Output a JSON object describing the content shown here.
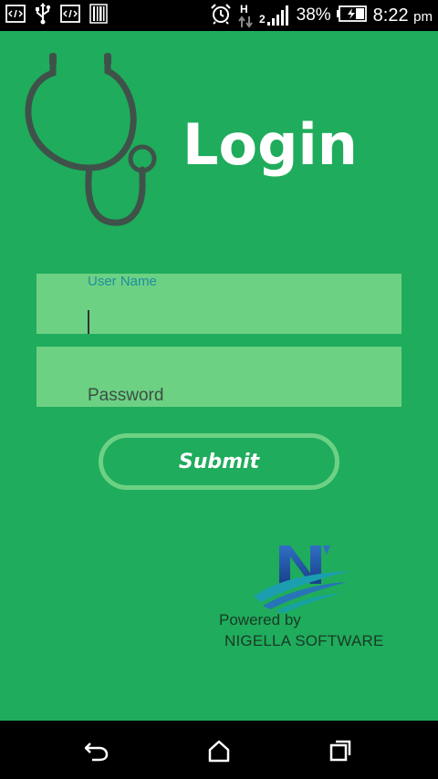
{
  "status_bar": {
    "left_icons": [
      "code-icon",
      "usb-icon",
      "code-icon",
      "barcode-icon"
    ],
    "right_icons": [
      "alarm-icon",
      "hplus-data-icon",
      "signal-icon",
      "battery-icon"
    ],
    "network_type": "H",
    "sim_label": "2",
    "battery_percent": "38%",
    "time": "8:22",
    "ampm": "pm"
  },
  "app": {
    "background_color": "#1fac5c",
    "field_color": "#6dd184",
    "title": "Login",
    "logo_icon": "stethoscope-icon",
    "username": {
      "label": "User Name",
      "value": ""
    },
    "password": {
      "placeholder": "Password",
      "value": ""
    },
    "submit_label": "Submit",
    "footer": {
      "brand_logo": "nigella-logo",
      "powered_by": "Powered by",
      "company": "NIGELLA SOFTWARE"
    }
  },
  "nav_bar": {
    "items": [
      "back-icon",
      "home-icon",
      "recents-icon"
    ]
  }
}
